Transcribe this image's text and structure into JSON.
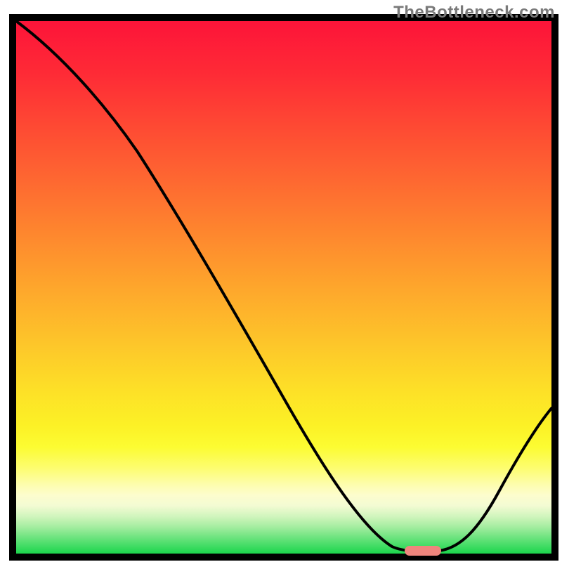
{
  "watermark": "TheBottleneck.com",
  "chart_data": {
    "type": "line",
    "title": "",
    "xlabel": "",
    "ylabel": "",
    "xlim": [
      0,
      100
    ],
    "ylim": [
      0,
      100
    ],
    "grid": false,
    "legend": false,
    "series": [
      {
        "name": "bottleneck-curve",
        "x": [
          0,
          5,
          10,
          15,
          20,
          25,
          30,
          35,
          40,
          45,
          50,
          55,
          60,
          65,
          70,
          75,
          80,
          85,
          90,
          95,
          100
        ],
        "y": [
          100,
          96,
          92,
          87,
          79,
          71,
          62,
          54,
          46,
          37,
          29,
          21,
          13,
          5,
          1,
          0,
          0,
          2,
          9,
          17,
          26
        ]
      }
    ],
    "marker": {
      "name": "optimal-point",
      "x_range": [
        73,
        80
      ],
      "color": "#ef857d"
    },
    "gradient_bands": [
      {
        "y": 100,
        "color": "#fd1439"
      },
      {
        "y": 90,
        "color": "#fe2b36"
      },
      {
        "y": 80,
        "color": "#fe4a33"
      },
      {
        "y": 70,
        "color": "#fe6831"
      },
      {
        "y": 60,
        "color": "#fe872e"
      },
      {
        "y": 50,
        "color": "#fea62c"
      },
      {
        "y": 40,
        "color": "#fdc42a"
      },
      {
        "y": 30,
        "color": "#fde227"
      },
      {
        "y": 24,
        "color": "#fcf126"
      },
      {
        "y": 20,
        "color": "#fcfc32"
      },
      {
        "y": 16,
        "color": "#fdfd71"
      },
      {
        "y": 13,
        "color": "#fdfdad"
      },
      {
        "y": 11,
        "color": "#fdfdcd"
      },
      {
        "y": 9,
        "color": "#f3fbd3"
      },
      {
        "y": 7,
        "color": "#d1f5bd"
      },
      {
        "y": 5,
        "color": "#a4eda0"
      },
      {
        "y": 3,
        "color": "#6ce37e"
      },
      {
        "y": 1,
        "color": "#36da5d"
      },
      {
        "y": 0,
        "color": "#1cd54d"
      }
    ]
  }
}
